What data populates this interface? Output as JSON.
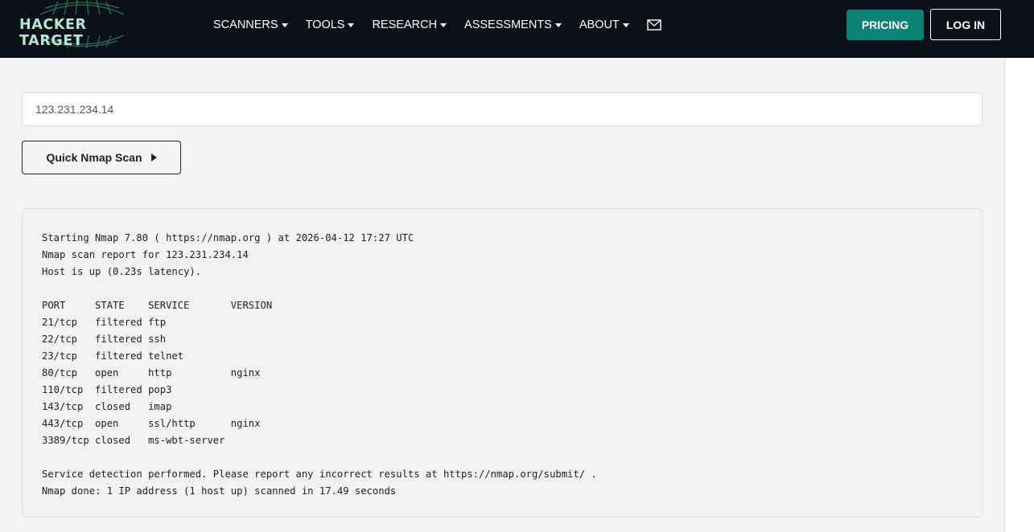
{
  "header": {
    "logo_text": "HACKER TARGET",
    "nav": [
      {
        "label": "SCANNERS",
        "has_dropdown": true,
        "icon": "caret-down-icon"
      },
      {
        "label": "TOOLS",
        "has_dropdown": true,
        "icon": "caret-down-icon"
      },
      {
        "label": "RESEARCH",
        "has_dropdown": true,
        "icon": "caret-down-icon"
      },
      {
        "label": "ASSESSMENTS",
        "has_dropdown": true,
        "icon": "caret-down-icon"
      },
      {
        "label": "ABOUT",
        "has_dropdown": true,
        "icon": "caret-down-icon"
      }
    ],
    "mail_icon": "envelope-icon",
    "pricing_label": "PRICING",
    "login_label": "LOG IN"
  },
  "scan": {
    "target_value": "123.231.234.14",
    "button_label": "Quick Nmap Scan",
    "button_icon": "play-icon"
  },
  "results": {
    "lines": [
      "Starting Nmap 7.80 ( https://nmap.org ) at 2026-04-12 17:27 UTC",
      "Nmap scan report for 123.231.234.14",
      "Host is up (0.23s latency).",
      "",
      "PORT     STATE    SERVICE       VERSION",
      "21/tcp   filtered ftp",
      "22/tcp   filtered ssh",
      "23/tcp   filtered telnet",
      "80/tcp   open     http          nginx",
      "110/tcp  filtered pop3",
      "143/tcp  closed   imap",
      "443/tcp  open     ssl/http      nginx",
      "3389/tcp closed   ms-wbt-server",
      "",
      "Service detection performed. Please report any incorrect results at https://nmap.org/submit/ .",
      "Nmap done: 1 IP address (1 host up) scanned in 17.49 seconds"
    ]
  },
  "colors": {
    "header_bg": "#0b1018",
    "accent": "#0c8175",
    "logo": "#b8e6cf",
    "panel_bg": "#f4f4f4"
  }
}
